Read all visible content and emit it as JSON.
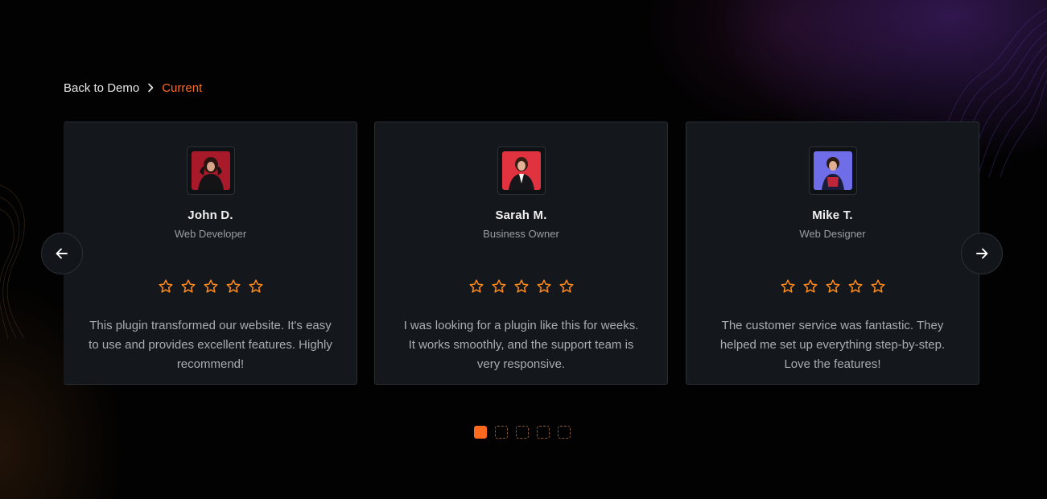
{
  "breadcrumb": {
    "back_label": "Back to Demo",
    "current_label": "Current"
  },
  "colors": {
    "accent": "#ff6a1f",
    "star": "#ff8a1a",
    "card_bg": "#14181c",
    "page_bg": "#020202"
  },
  "navigation": {
    "prev_icon": "arrow-left-icon",
    "next_icon": "arrow-right-icon"
  },
  "testimonials": [
    {
      "name": "John D.",
      "role": "Web Developer",
      "rating": 5,
      "text": "This plugin transformed our website. It's easy to use and provides excellent features. Highly recommend!",
      "avatar_bg": "#a8192a"
    },
    {
      "name": "Sarah M.",
      "role": "Business Owner",
      "rating": 5,
      "text": "I was looking for a plugin like this for weeks. It works smoothly, and the support team is very responsive.",
      "avatar_bg": "#e0323f"
    },
    {
      "name": "Mike T.",
      "role": "Web Designer",
      "rating": 5,
      "text": "The customer service was fantastic. They helped me set up everything step-by-step. Love the features!",
      "avatar_bg": "#6f6ee8"
    }
  ],
  "pagination": {
    "total": 5,
    "active_index": 0
  }
}
